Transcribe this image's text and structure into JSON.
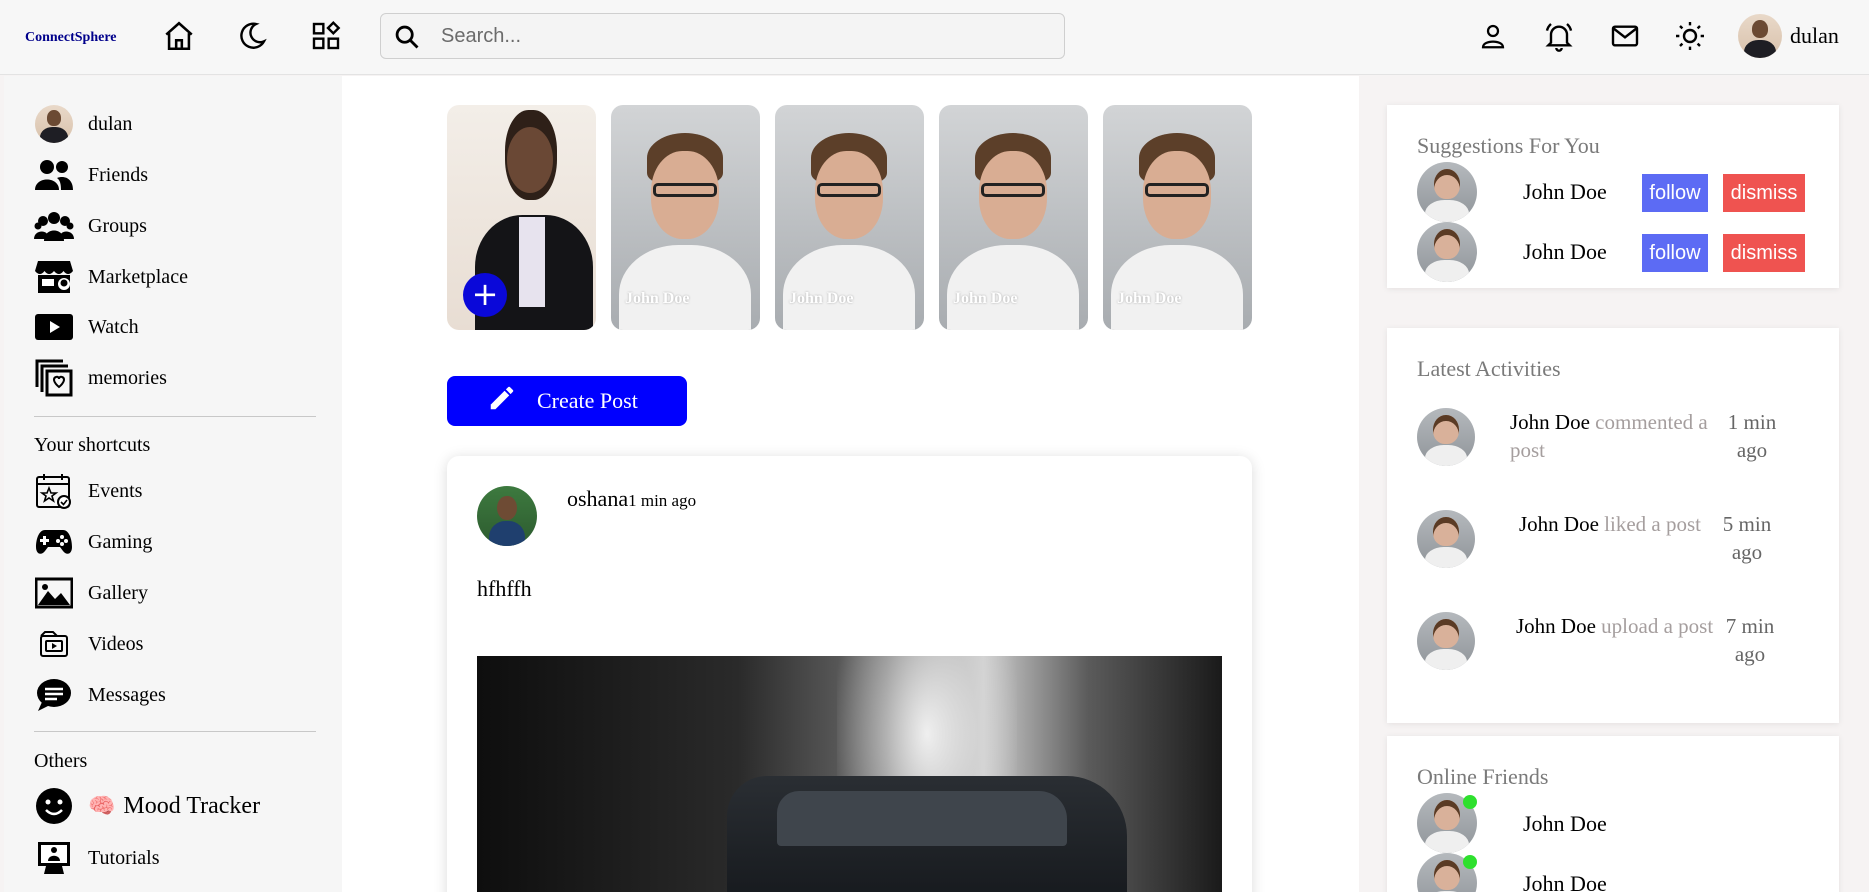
{
  "brand": {
    "logo": "ConnectSphere"
  },
  "navbar": {
    "search_placeholder": "Search...",
    "username": "dulan",
    "left_icons": [
      "home-icon",
      "moon-icon",
      "apps-icon"
    ],
    "right_icons": [
      "user-icon",
      "bell-icon",
      "mail-icon",
      "sun-icon"
    ]
  },
  "sidebar": {
    "main": [
      {
        "label": "dulan",
        "icon": "avatar"
      },
      {
        "label": "Friends",
        "icon": "friends-icon"
      },
      {
        "label": "Groups",
        "icon": "groups-icon"
      },
      {
        "label": "Marketplace",
        "icon": "marketplace-icon"
      },
      {
        "label": "Watch",
        "icon": "watch-icon"
      },
      {
        "label": "memories",
        "icon": "memories-icon"
      }
    ],
    "shortcuts_title": "Your shortcuts",
    "shortcuts": [
      {
        "label": "Events",
        "icon": "events-icon"
      },
      {
        "label": "Gaming",
        "icon": "gamepad-icon"
      },
      {
        "label": "Gallery",
        "icon": "gallery-icon"
      },
      {
        "label": "Videos",
        "icon": "videos-icon"
      },
      {
        "label": "Messages",
        "icon": "messages-icon"
      }
    ],
    "others_title": "Others",
    "others": [
      {
        "label": "Mood Tracker",
        "icon": "smiley-icon",
        "emoji": "🧠"
      },
      {
        "label": "Tutorials",
        "icon": "tutorials-icon"
      }
    ]
  },
  "stories": [
    {
      "own": true,
      "name": ""
    },
    {
      "own": false,
      "name": "John Doe"
    },
    {
      "own": false,
      "name": "John Doe"
    },
    {
      "own": false,
      "name": "John Doe"
    },
    {
      "own": false,
      "name": "John Doe"
    }
  ],
  "create_post_label": "Create Post",
  "post": {
    "author": "oshana",
    "time": "1 min ago",
    "text": "hfhffh"
  },
  "suggestions": {
    "title": "Suggestions For You",
    "items": [
      {
        "name": "John Doe",
        "follow_label": "follow",
        "dismiss_label": "dismiss"
      },
      {
        "name": "John Doe",
        "follow_label": "follow",
        "dismiss_label": "dismiss"
      }
    ]
  },
  "activities": {
    "title": "Latest Activities",
    "items": [
      {
        "who": "John Doe",
        "what": "commented a post",
        "time": "1 min ago"
      },
      {
        "who": "John Doe",
        "what": "liked a post",
        "time": "5 min ago"
      },
      {
        "who": "John Doe",
        "what": "upload a post",
        "time": "7 min ago"
      }
    ]
  },
  "online": {
    "title": "Online Friends",
    "items": [
      {
        "name": "John Doe",
        "status_color": "#2ee02e"
      },
      {
        "name": "John Doe",
        "status_color": "#2ee02e"
      }
    ]
  },
  "colors": {
    "primary": "#0000ff",
    "follow": "#5c6bf4",
    "dismiss": "#ef5350",
    "logo": "#00008b"
  }
}
